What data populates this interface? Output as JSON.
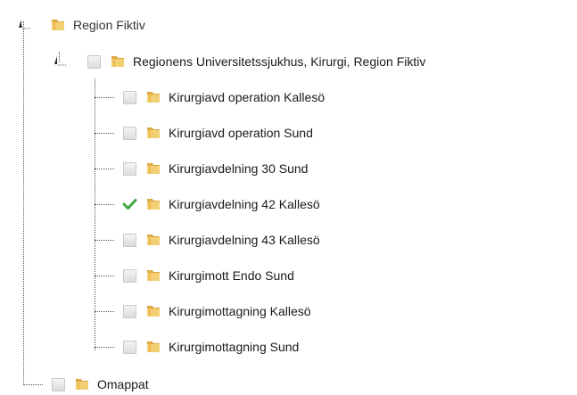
{
  "tree": {
    "root": {
      "label": "Region Fiktiv",
      "expanded": true,
      "children": [
        {
          "label": "Regionens Universitetssjukhus, Kirurgi, Region Fiktiv",
          "expanded": true,
          "checked": false,
          "children": [
            {
              "label": "Kirurgiavd operation Kallesö",
              "checked": false
            },
            {
              "label": "Kirurgiavd operation Sund",
              "checked": false
            },
            {
              "label": "Kirurgiavdelning 30 Sund",
              "checked": false
            },
            {
              "label": "Kirurgiavdelning 42 Kallesö",
              "checked": true
            },
            {
              "label": "Kirurgiavdelning 43 Kallesö",
              "checked": false
            },
            {
              "label": "Kirurgimott Endo Sund",
              "checked": false
            },
            {
              "label": "Kirurgimottagning Kallesö",
              "checked": false
            },
            {
              "label": "Kirurgimottagning Sund",
              "checked": false
            }
          ]
        },
        {
          "label": "Omappat",
          "checked": false
        }
      ]
    },
    "colors": {
      "check": "#3fa83f",
      "folder_light": "#f3cf73",
      "folder_dark": "#d9a53a",
      "line": "#555555"
    },
    "icons": {
      "expander": "collapse-arrow-icon",
      "folder": "folder-icon",
      "checkbox": "checkbox-icon",
      "check": "checkmark-icon"
    }
  }
}
